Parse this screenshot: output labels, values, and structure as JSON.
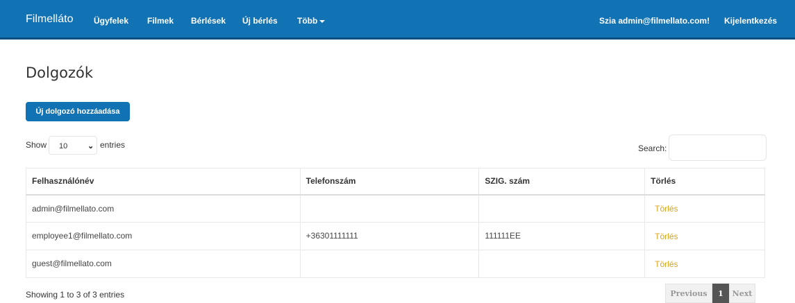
{
  "navbar": {
    "brand": "Filmelláto",
    "items": [
      {
        "label": "Ügyfelek"
      },
      {
        "label": "Filmek"
      },
      {
        "label": "Bérlések"
      },
      {
        "label": "Új bérlés"
      },
      {
        "label": "Több"
      }
    ],
    "greeting": "Szia admin@filmellato.com!",
    "logout": "Kijelentkezés"
  },
  "page": {
    "title": "Dolgozók",
    "add_button": "Új dolgozó hozzáadása"
  },
  "table_controls": {
    "show_label": "Show",
    "page_length": "10",
    "entries_label": "entries",
    "search_label": "Search:",
    "search_value": ""
  },
  "table": {
    "columns": [
      "Felhasználónév",
      "Telefonszám",
      "SZIG. szám",
      "Törlés"
    ],
    "rows": [
      {
        "username": "admin@filmellato.com",
        "phone": "",
        "id_number": "",
        "delete": "Törlés"
      },
      {
        "username": "employee1@filmellato.com",
        "phone": "+36301111111",
        "id_number": "111111EE",
        "delete": "Törlés"
      },
      {
        "username": "guest@filmellato.com",
        "phone": "",
        "id_number": "",
        "delete": "Törlés"
      }
    ]
  },
  "footer": {
    "info": "Showing 1 to 3 of 3 entries",
    "pagination": {
      "previous": "Previous",
      "current": "1",
      "next": "Next"
    }
  },
  "colors": {
    "navbar": "#1172b4",
    "navbar_border": "#0c4f7e",
    "delete_link": "#d6a41c",
    "current_page": "#555555"
  }
}
